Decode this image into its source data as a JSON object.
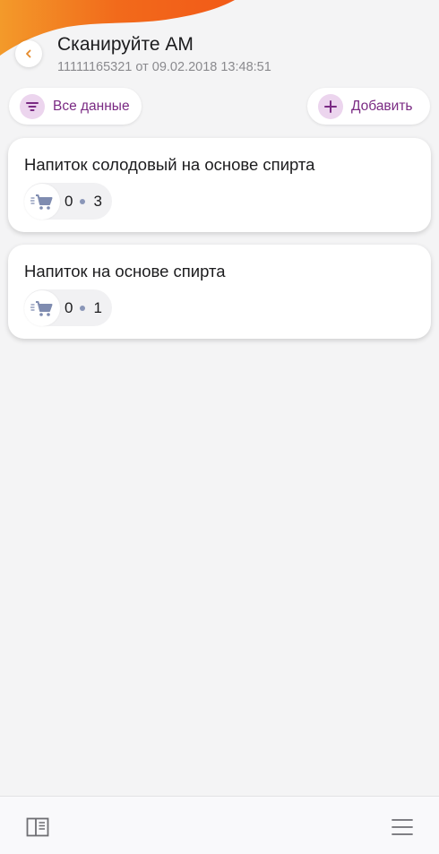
{
  "header": {
    "title": "Сканируйте АМ",
    "subtitle": "11111165321 от 09.02.2018 13:48:51"
  },
  "actions": {
    "filter_label": "Все данные",
    "add_label": "Добавить"
  },
  "items": [
    {
      "title": "Напиток солодовый на основе спирта",
      "count_scanned": "0",
      "count_total": "3"
    },
    {
      "title": "Напиток на основе спирта",
      "count_scanned": "0",
      "count_total": "1"
    }
  ],
  "colors": {
    "accent": "#7a2a83",
    "accent_bg": "#ecd5ee",
    "wave": "#f26a1b",
    "back_arrow": "#e58a2a",
    "cart": "#7f8cb0"
  },
  "icons": {
    "back": "chevron-left-icon",
    "filter": "filter-icon",
    "add": "plus-icon",
    "cart": "cart-icon",
    "nav_left": "book-icon",
    "nav_right": "menu-icon"
  }
}
